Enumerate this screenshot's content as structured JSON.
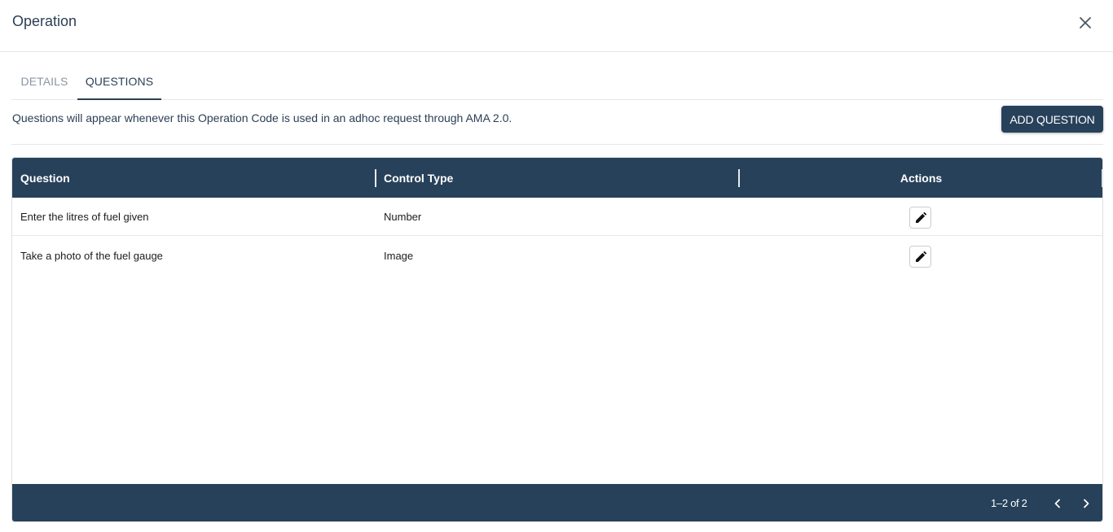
{
  "dialog": {
    "title": "Operation",
    "close_icon": "close-icon"
  },
  "tabs": [
    {
      "label": "DETAILS",
      "active": false
    },
    {
      "label": "QUESTIONS",
      "active": true
    }
  ],
  "info_text": "Questions will appear whenever this Operation Code is used in an adhoc request through AMA 2.0.",
  "add_button_label": "ADD QUESTION",
  "table": {
    "columns": [
      "Question",
      "Control Type",
      "Actions"
    ],
    "rows": [
      {
        "question": "Enter the litres of fuel given",
        "control_type": "Number",
        "action_icon": "pencil-icon"
      },
      {
        "question": "Take a photo of the fuel gauge",
        "control_type": "Image",
        "action_icon": "pencil-icon"
      }
    ]
  },
  "pagination": {
    "label": "1–2 of 2",
    "prev_icon": "chevron-left-icon",
    "next_icon": "chevron-right-icon"
  },
  "colors": {
    "header_bg": "#27415a",
    "title_text": "#2b3f55",
    "inactive_tab": "#8b96a3"
  }
}
